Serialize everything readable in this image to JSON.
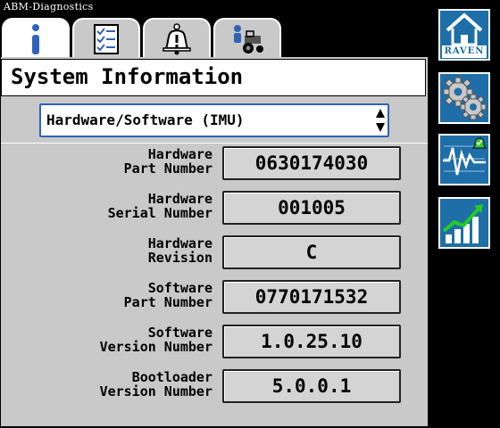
{
  "app": {
    "title": "ABM-Diagnostics"
  },
  "tabs": [
    {
      "name": "info",
      "icon": "info-icon",
      "active": true
    },
    {
      "name": "checklist",
      "icon": "checklist-icon",
      "active": false
    },
    {
      "name": "alarms",
      "icon": "alarm-bell-icon",
      "active": false
    },
    {
      "name": "machine",
      "icon": "operator-tractor-icon",
      "active": false
    }
  ],
  "page": {
    "title": "System Information"
  },
  "selector": {
    "value": "Hardware/Software (IMU)"
  },
  "fields": [
    {
      "label": "Hardware\nPart Number",
      "value": "0630174030"
    },
    {
      "label": "Hardware\nSerial Number",
      "value": "001005"
    },
    {
      "label": "Hardware\nRevision",
      "value": "C"
    },
    {
      "label": "Software\nPart Number",
      "value": "0770171532"
    },
    {
      "label": "Software\nVersion Number",
      "value": "1.0.25.10"
    },
    {
      "label": "Bootloader\nVersion Number",
      "value": "5.0.0.1"
    }
  ],
  "sidebar": {
    "home": {
      "brand": "RAVEN",
      "icon": "home-icon"
    },
    "settings": {
      "icon": "gears-icon"
    },
    "diagnostics": {
      "icon": "diagnostics-waveform-icon"
    },
    "performance": {
      "icon": "bar-chart-trend-icon"
    }
  },
  "colors": {
    "accent": "#2e63b8",
    "sidebar": "#1e6ea8",
    "panel": "#c9c9c9"
  }
}
